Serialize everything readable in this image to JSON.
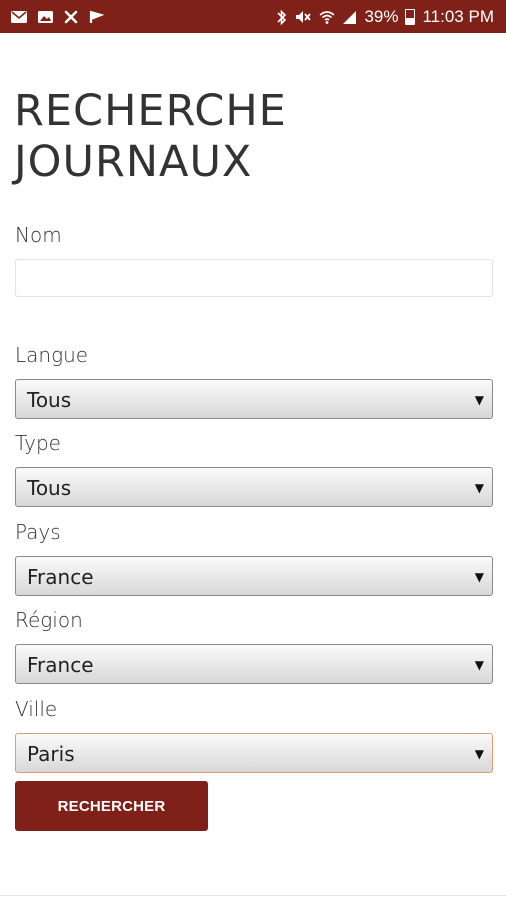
{
  "status_bar": {
    "battery": "39%",
    "time": "11:03 PM",
    "icons_left": [
      "mail-icon",
      "image-icon",
      "sync-off-icon",
      "flag-icon"
    ],
    "icons_right": [
      "bluetooth-icon",
      "mute-icon",
      "wifi-icon",
      "signal-icon",
      "battery-icon"
    ]
  },
  "page": {
    "title_line1": "RECHERCHE",
    "title_line2": "JOURNAUX"
  },
  "form": {
    "nom_label": "Nom",
    "nom_value": "",
    "langue_label": "Langue",
    "langue_value": "Tous",
    "type_label": "Type",
    "type_value": "Tous",
    "pays_label": "Pays",
    "pays_value": "France",
    "region_label": "Région",
    "region_value": "France",
    "ville_label": "Ville",
    "ville_value": "Paris",
    "submit_label": "RECHERCHER"
  },
  "colors": {
    "brand": "#7f2119",
    "focus_border": "#d9a06a"
  }
}
